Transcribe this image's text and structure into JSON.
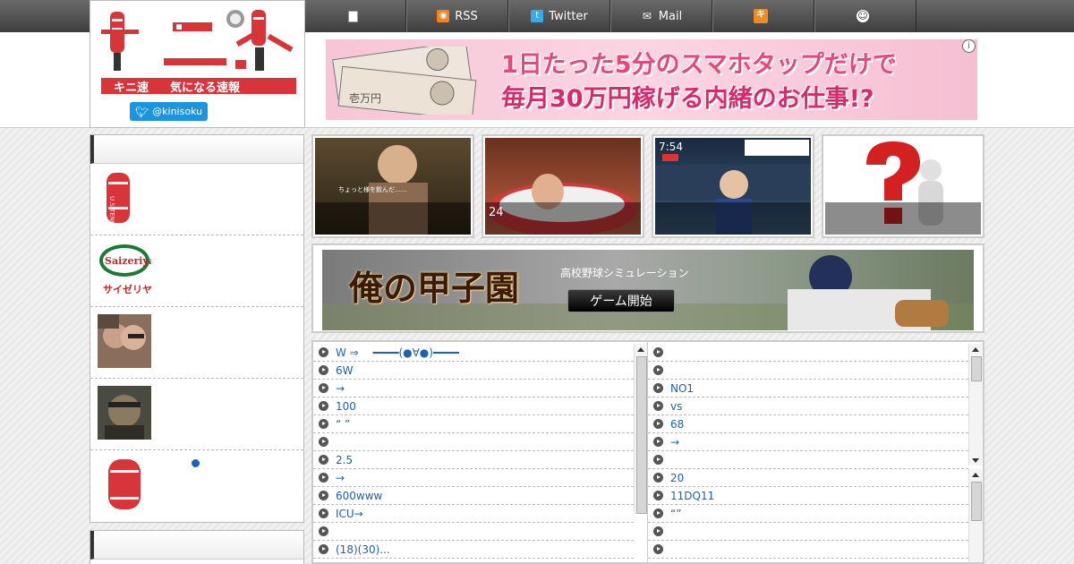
{
  "nav": {
    "items": [
      {
        "icon": "document-icon",
        "label": ""
      },
      {
        "icon": "rss-icon",
        "label": "RSS"
      },
      {
        "icon": "twitter-icon",
        "label": "Twitter"
      },
      {
        "icon": "mail-icon",
        "label": "Mail"
      },
      {
        "icon": "kini-icon",
        "label": ""
      },
      {
        "icon": "face-icon",
        "label": ""
      }
    ]
  },
  "logo": {
    "name": "キニ速",
    "tagline": "気になる速報",
    "twitter_handle": "@kinisoku"
  },
  "ad_banner": {
    "line1": "1日たった5分のスマホタップだけで",
    "line2": "毎月30万円稼げる内緒のお仕事!?",
    "info": "i"
  },
  "thumbnails": [
    {
      "caption": ""
    },
    {
      "caption": "24"
    },
    {
      "caption": ""
    },
    {
      "caption": ""
    }
  ],
  "game_ad": {
    "title": "俺の甲子園",
    "subtitle": "高校野球シミュレーション",
    "button": "ゲーム開始"
  },
  "sidebar": {
    "dot_color": "#1a63c0"
  },
  "list_left": [
    "W ⇒　 ━━━━(●∀●)━━━━",
    "6W",
    " →",
    "100",
    "“ ”",
    "",
    "2.5",
    " →",
    "600www",
    "ICU→",
    "",
    "(18)(30)..."
  ],
  "list_right_top": [
    "",
    "",
    "NO1",
    "vs",
    "68",
    "→",
    ""
  ],
  "list_right_bottom": [
    "20",
    "11DQ11",
    "“”",
    "",
    "",
    ""
  ],
  "colors": {
    "link": "#1a63b0",
    "accent_red": "#d8353b",
    "twitter_blue": "#1b95e0"
  }
}
